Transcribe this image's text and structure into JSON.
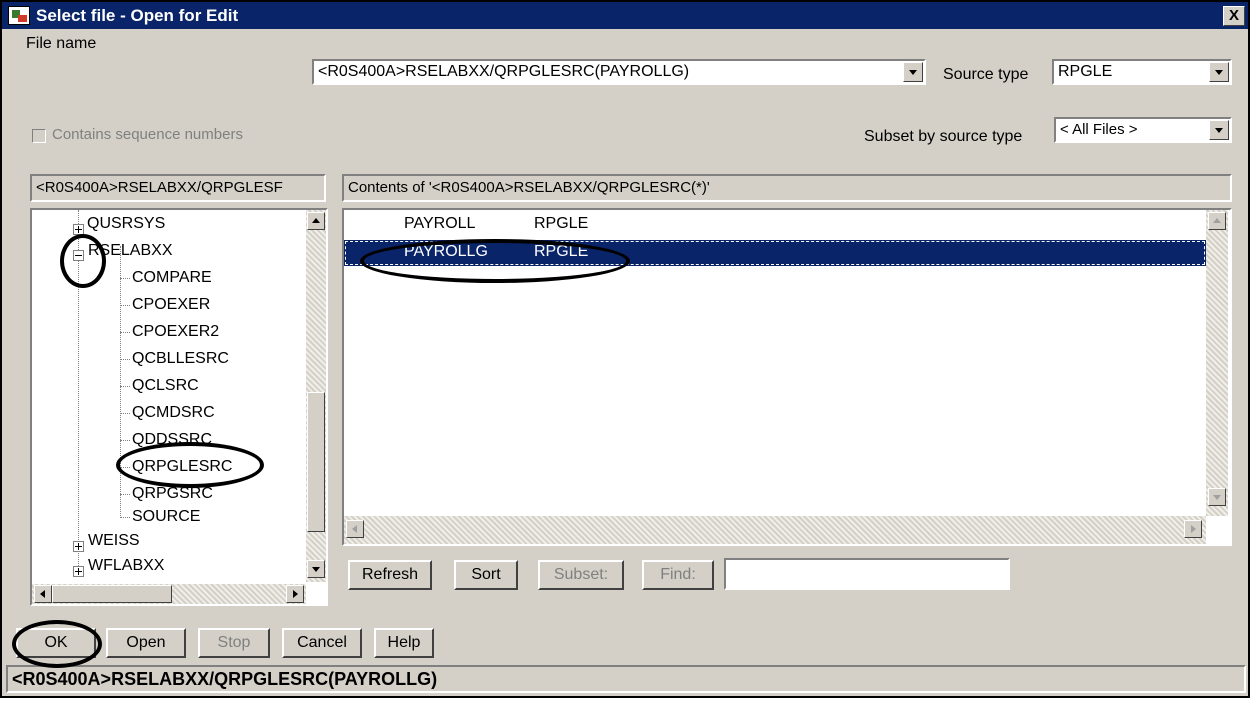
{
  "window": {
    "title": "Select file - Open for Edit",
    "close_glyph": "X"
  },
  "file_name": {
    "label": "File name",
    "value": "<R0S400A>RSELABXX/QRPGLESRC(PAYROLLG)"
  },
  "source_type": {
    "label": "Source type",
    "value": "RPGLE"
  },
  "sequence_checkbox": {
    "label": "Contains sequence numbers",
    "checked": false
  },
  "subset": {
    "label": "Subset by source type",
    "value": "< All Files >"
  },
  "tree_path": "<R0S400A>RSELABXX/QRPGLESF",
  "contents_path": "Contents of '<R0S400A>RSELABXX/QRPGLESRC(*)'",
  "tree": {
    "items": [
      {
        "label": "QUSRSYS",
        "expander": "plus"
      },
      {
        "label": "RSELABXX",
        "expander": "minus"
      },
      {
        "label": "COMPARE"
      },
      {
        "label": "CPOEXER"
      },
      {
        "label": "CPOEXER2"
      },
      {
        "label": "QCBLLESRC"
      },
      {
        "label": "QCLSRC"
      },
      {
        "label": "QCMDSRC"
      },
      {
        "label": "QDDSSRC"
      },
      {
        "label": "QRPGLESRC"
      },
      {
        "label": "QRPGSRC"
      },
      {
        "label": "SOURCE"
      },
      {
        "label": "WEISS",
        "expander": "plus"
      },
      {
        "label": "WFLABXX",
        "expander": "plus"
      }
    ]
  },
  "files": {
    "rows": [
      {
        "name": "PAYROLL",
        "type": "RPGLE",
        "selected": false
      },
      {
        "name": "PAYROLLG",
        "type": "RPGLE",
        "selected": true
      }
    ]
  },
  "list_buttons": {
    "refresh": "Refresh",
    "sort": "Sort",
    "subset": "Subset:",
    "find": "Find:"
  },
  "find_value": "",
  "dialog_buttons": {
    "ok": "OK",
    "open": "Open",
    "stop": "Stop",
    "cancel": "Cancel",
    "help": "Help"
  },
  "status": "<R0S400A>RSELABXX/QRPGLESRC(PAYROLLG)",
  "colors": {
    "titlebar": "#0a246a",
    "selection": "#0a246a",
    "face": "#d4d0c8"
  }
}
